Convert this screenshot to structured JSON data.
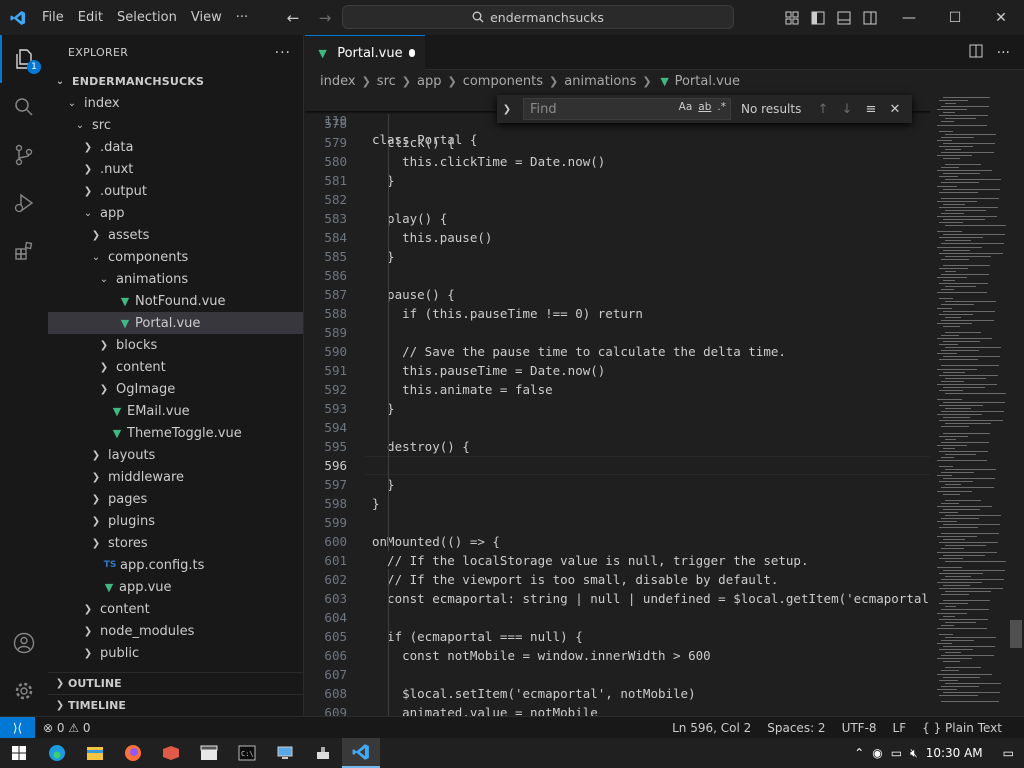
{
  "titlebar": {
    "menu": [
      "File",
      "Edit",
      "Selection",
      "View",
      "···"
    ],
    "search_text": "endermanchsucks"
  },
  "activity": {
    "explorer_badge": "1"
  },
  "sidebar": {
    "title": "EXPLORER",
    "tree": [
      {
        "label": "ENDERMANCHSUCKS",
        "indent": 0,
        "kind": "root-open"
      },
      {
        "label": "index",
        "indent": 1,
        "kind": "folder-open"
      },
      {
        "label": "src",
        "indent": 2,
        "kind": "folder-open"
      },
      {
        "label": ".data",
        "indent": 3,
        "kind": "folder"
      },
      {
        "label": ".nuxt",
        "indent": 3,
        "kind": "folder"
      },
      {
        "label": ".output",
        "indent": 3,
        "kind": "folder"
      },
      {
        "label": "app",
        "indent": 3,
        "kind": "folder-open"
      },
      {
        "label": "assets",
        "indent": 4,
        "kind": "folder"
      },
      {
        "label": "components",
        "indent": 4,
        "kind": "folder-open"
      },
      {
        "label": "animations",
        "indent": 5,
        "kind": "folder-open"
      },
      {
        "label": "NotFound.vue",
        "indent": 6,
        "kind": "vue"
      },
      {
        "label": "Portal.vue",
        "indent": 6,
        "kind": "vue",
        "selected": true
      },
      {
        "label": "blocks",
        "indent": 5,
        "kind": "folder"
      },
      {
        "label": "content",
        "indent": 5,
        "kind": "folder"
      },
      {
        "label": "OgImage",
        "indent": 5,
        "kind": "folder"
      },
      {
        "label": "EMail.vue",
        "indent": 5,
        "kind": "vue"
      },
      {
        "label": "ThemeToggle.vue",
        "indent": 5,
        "kind": "vue"
      },
      {
        "label": "layouts",
        "indent": 4,
        "kind": "folder"
      },
      {
        "label": "middleware",
        "indent": 4,
        "kind": "folder"
      },
      {
        "label": "pages",
        "indent": 4,
        "kind": "folder"
      },
      {
        "label": "plugins",
        "indent": 4,
        "kind": "folder"
      },
      {
        "label": "stores",
        "indent": 4,
        "kind": "folder"
      },
      {
        "label": "app.config.ts",
        "indent": 4,
        "kind": "ts"
      },
      {
        "label": "app.vue",
        "indent": 4,
        "kind": "vue"
      },
      {
        "label": "content",
        "indent": 3,
        "kind": "folder"
      },
      {
        "label": "node_modules",
        "indent": 3,
        "kind": "folder"
      },
      {
        "label": "public",
        "indent": 3,
        "kind": "folder"
      }
    ],
    "outline": "OUTLINE",
    "timeline": "TIMELINE"
  },
  "tab": {
    "label": "Portal.vue"
  },
  "breadcrumb": [
    "index",
    "src",
    "app",
    "components",
    "animations",
    "Portal.vue"
  ],
  "find": {
    "placeholder": "Find",
    "opt_case": "Aa",
    "opt_word": "ab",
    "opt_regex": ".*",
    "results": "No results"
  },
  "code": {
    "sticky": {
      "n": "110",
      "text": "class Portal {"
    },
    "lines": [
      {
        "n": "578",
        "text": ""
      },
      {
        "n": "579",
        "text": "  click() {"
      },
      {
        "n": "580",
        "text": "    this.clickTime = Date.now()"
      },
      {
        "n": "581",
        "text": "  }"
      },
      {
        "n": "582",
        "text": ""
      },
      {
        "n": "583",
        "text": "  play() {"
      },
      {
        "n": "584",
        "text": "    this.pause()"
      },
      {
        "n": "585",
        "text": "  }"
      },
      {
        "n": "586",
        "text": ""
      },
      {
        "n": "587",
        "text": "  pause() {"
      },
      {
        "n": "588",
        "text": "    if (this.pauseTime !== 0) return"
      },
      {
        "n": "589",
        "text": ""
      },
      {
        "n": "590",
        "text": "    // Save the pause time to calculate the delta time."
      },
      {
        "n": "591",
        "text": "    this.pauseTime = Date.now()"
      },
      {
        "n": "592",
        "text": "    this.animate = false"
      },
      {
        "n": "593",
        "text": "  }"
      },
      {
        "n": "594",
        "text": ""
      },
      {
        "n": "595",
        "text": "  destroy() {"
      },
      {
        "n": "596",
        "text": "",
        "current": true
      },
      {
        "n": "597",
        "text": "  }"
      },
      {
        "n": "598",
        "text": "}"
      },
      {
        "n": "599",
        "text": ""
      },
      {
        "n": "600",
        "text": "onMounted(() => {"
      },
      {
        "n": "601",
        "text": "  // If the localStorage value is null, trigger the setup."
      },
      {
        "n": "602",
        "text": "  // If the viewport is too small, disable by default."
      },
      {
        "n": "603",
        "text": "  const ecmaportal: string | null | undefined = $local.getItem('ecmaportal"
      },
      {
        "n": "604",
        "text": ""
      },
      {
        "n": "605",
        "text": "  if (ecmaportal === null) {"
      },
      {
        "n": "606",
        "text": "    const notMobile = window.innerWidth > 600"
      },
      {
        "n": "607",
        "text": ""
      },
      {
        "n": "608",
        "text": "    $local.setItem('ecmaportal', notMobile)"
      },
      {
        "n": "609",
        "text": "    animated.value = notMobile"
      }
    ]
  },
  "status": {
    "problems": "⊗ 0 ⚠ 0",
    "position": "Ln 596, Col 2",
    "spaces": "Spaces: 2",
    "encoding": "UTF-8",
    "eol": "LF",
    "language": "{ } Plain Text"
  },
  "taskbar": {
    "time": "10:30 AM"
  }
}
